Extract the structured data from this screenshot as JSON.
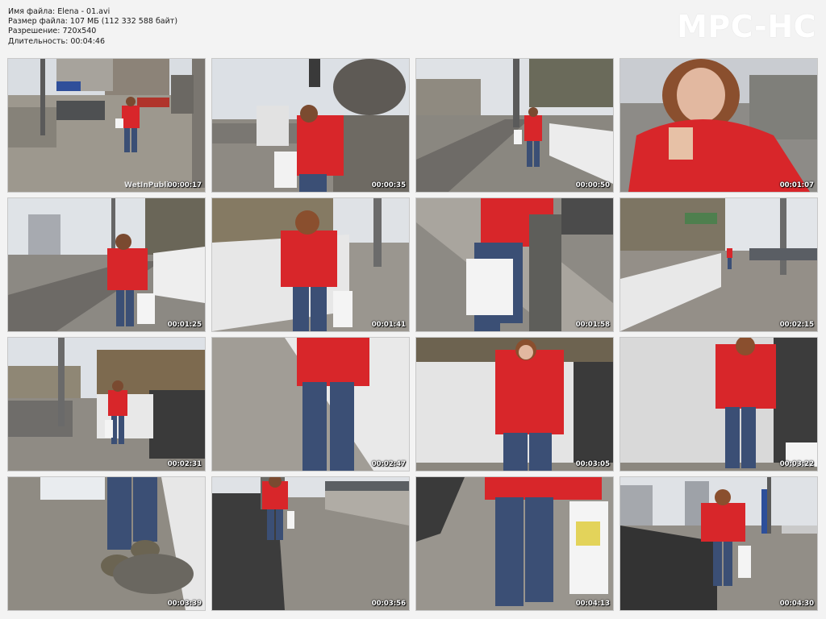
{
  "file_info": {
    "name_line": "Имя файла: Elena - 01.avi",
    "size_line": "Размер файла: 107 МБ (112 332 588 байт)",
    "resolution_line": "Разрешение: 720x540",
    "duration_line": "Длительность: 00:04:46"
  },
  "logo": "MPC-HC",
  "watermark": "WetInPublic",
  "thumbnails": [
    {
      "time": "00:00:17"
    },
    {
      "time": "00:00:35"
    },
    {
      "time": "00:00:50"
    },
    {
      "time": "00:01:07"
    },
    {
      "time": "00:01:25"
    },
    {
      "time": "00:01:41"
    },
    {
      "time": "00:01:58"
    },
    {
      "time": "00:02:15"
    },
    {
      "time": "00:02:31"
    },
    {
      "time": "00:02:47"
    },
    {
      "time": "00:03:05"
    },
    {
      "time": "00:03:22"
    },
    {
      "time": "00:03:39"
    },
    {
      "time": "00:03:56"
    },
    {
      "time": "00:04:13"
    },
    {
      "time": "00:04:30"
    }
  ],
  "colors": {
    "background": "#f3f3f3",
    "jacket_red": "#d8262a",
    "jeans_blue": "#3b4f75",
    "pavement": "#9a958c",
    "sky": "#dfe3e8"
  }
}
